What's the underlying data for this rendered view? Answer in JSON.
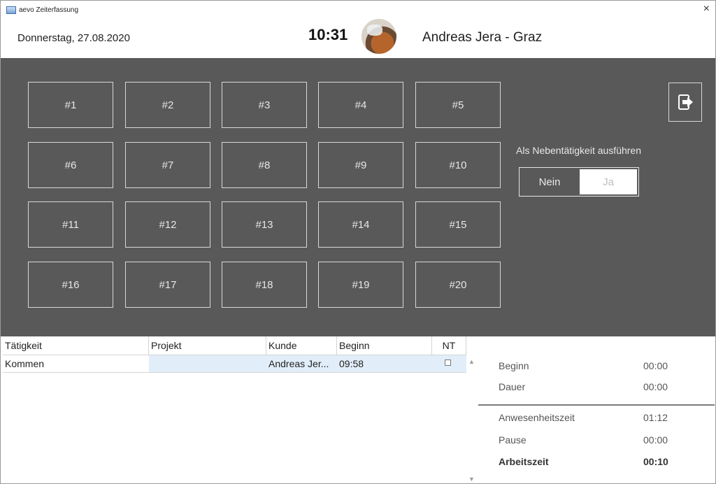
{
  "window": {
    "title": "aevo Zeiterfassung",
    "close_symbol": "×"
  },
  "header": {
    "date": "Donnerstag, 27.08.2020",
    "time": "10:31",
    "user": "Andreas Jera - Graz"
  },
  "activities": [
    {
      "label": "#1"
    },
    {
      "label": "#2"
    },
    {
      "label": "#3"
    },
    {
      "label": "#4"
    },
    {
      "label": "#5"
    },
    {
      "label": "#6"
    },
    {
      "label": "#7"
    },
    {
      "label": "#8"
    },
    {
      "label": "#9"
    },
    {
      "label": "#10"
    },
    {
      "label": "#11"
    },
    {
      "label": "#12"
    },
    {
      "label": "#13"
    },
    {
      "label": "#14"
    },
    {
      "label": "#15"
    },
    {
      "label": "#16"
    },
    {
      "label": "#17"
    },
    {
      "label": "#18"
    },
    {
      "label": "#19"
    },
    {
      "label": "#20"
    }
  ],
  "side": {
    "nebentaetigkeit_label": "Als Nebentätigkeit ausführen",
    "toggle": {
      "off": "Nein",
      "on": "Ja",
      "selected": "Nein"
    },
    "logout_icon": "logout-icon"
  },
  "table": {
    "columns": [
      "Tätigkeit",
      "Projekt",
      "Kunde",
      "Beginn",
      "NT"
    ],
    "rows": [
      {
        "taetigkeit": "Kommen",
        "projekt": "",
        "kunde": "Andreas Jer...",
        "beginn": "09:58",
        "nt": false
      }
    ]
  },
  "summary": {
    "beginn_label": "Beginn",
    "beginn": "00:00",
    "dauer_label": "Dauer",
    "dauer": "00:00",
    "anwesenheit_label": "Anwesenheitszeit",
    "anwesenheit": "01:12",
    "pause_label": "Pause",
    "pause": "00:00",
    "arbeitszeit_label": "Arbeitszeit",
    "arbeitszeit": "00:10"
  },
  "colors": {
    "panel": "#595959",
    "selected_row": "#e1eef9",
    "button_border": "#d8d8d8"
  }
}
